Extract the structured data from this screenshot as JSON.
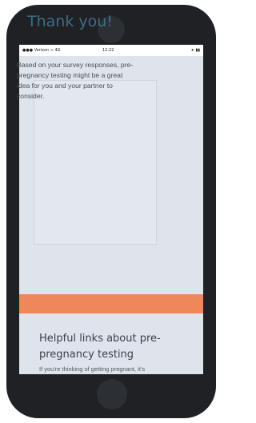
{
  "status_bar": {
    "carrier": "Verizon",
    "network": "4G",
    "time": "12:22"
  },
  "card": {
    "title": "Thank you!",
    "body": "Based on your survey responses, pre-pregnancy testing might be a great idea for you and your partner to consider."
  },
  "links_section": {
    "title": "Helpful links about pre-pregnancy testing",
    "intro": "If you're thinking of getting pregnant, it's"
  },
  "colors": {
    "accent_orange": "#ee8759",
    "title_blue": "#3f6d86",
    "screen_background": "#dfe3ec",
    "phone_frame": "#1f2124"
  },
  "icons": {
    "signal": "signal-icon",
    "wifi": "wifi-icon",
    "location": "location-icon",
    "battery": "battery-icon"
  }
}
